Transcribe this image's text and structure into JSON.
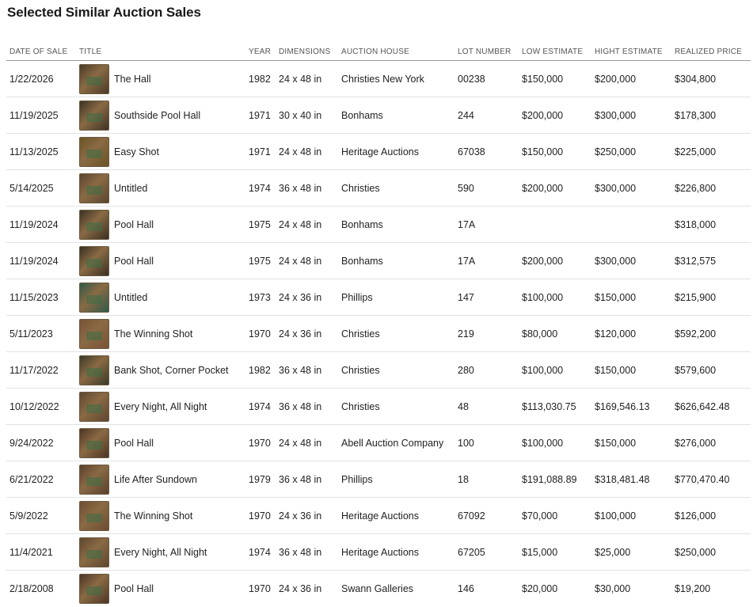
{
  "page": {
    "title": "Selected Similar Auction Sales"
  },
  "table": {
    "columns": {
      "date": "DATE OF SALE",
      "title": "TITLE",
      "year": "YEAR",
      "dimensions": "DIMENSIONS",
      "house": "AUCTION HOUSE",
      "lot": "LOT NUMBER",
      "low": "LOW ESTIMATE",
      "high": "HIGHT ESTIMATE",
      "price": "REALIZED PRICE"
    },
    "rows": [
      {
        "date": "1/22/2026",
        "title": "The Hall",
        "year": "1982",
        "dimensions": "24 x 48 in",
        "house": "Christies New York",
        "lot": "00238",
        "low": "$150,000",
        "high": "$200,000",
        "price": "$304,800",
        "thumb": "#4a3b28"
      },
      {
        "date": "11/19/2025",
        "title": "Southside Pool Hall",
        "year": "1971",
        "dimensions": "30 x 40 in",
        "house": "Bonhams",
        "lot": "244",
        "low": "$200,000",
        "high": "$300,000",
        "price": "$178,300",
        "thumb": "#3d3326"
      },
      {
        "date": "11/13/2025",
        "title": "Easy Shot",
        "year": "1971",
        "dimensions": "24 x 48 in",
        "house": "Heritage Auctions",
        "lot": "67038",
        "low": "$150,000",
        "high": "$250,000",
        "price": "$225,000",
        "thumb": "#6b5424"
      },
      {
        "date": "5/14/2025",
        "title": "Untitled",
        "year": "1974",
        "dimensions": "36 x 48 in",
        "house": "Christies",
        "lot": "590",
        "low": "$200,000",
        "high": "$300,000",
        "price": "$226,800",
        "thumb": "#5a4530"
      },
      {
        "date": "11/19/2024",
        "title": "Pool Hall",
        "year": "1975",
        "dimensions": "24 x 48 in",
        "house": "Bonhams",
        "lot": "17A",
        "low": "",
        "high": "",
        "price": "$318,000",
        "thumb": "#3a3022"
      },
      {
        "date": "11/19/2024",
        "title": "Pool Hall",
        "year": "1975",
        "dimensions": "24 x 48 in",
        "house": "Bonhams",
        "lot": "17A",
        "low": "$200,000",
        "high": "$300,000",
        "price": "$312,575",
        "thumb": "#3a3022"
      },
      {
        "date": "11/15/2023",
        "title": "Untitled",
        "year": "1973",
        "dimensions": "24 x 36 in",
        "house": "Phillips",
        "lot": "147",
        "low": "$100,000",
        "high": "$150,000",
        "price": "$215,900",
        "thumb": "#2f5a48"
      },
      {
        "date": "5/11/2023",
        "title": "The Winning Shot",
        "year": "1970",
        "dimensions": "24 x 36 in",
        "house": "Christies",
        "lot": "219",
        "low": "$80,000",
        "high": "$120,000",
        "price": "$592,200",
        "thumb": "#7a5236"
      },
      {
        "date": "11/17/2022",
        "title": "Bank Shot, Corner Pocket",
        "year": "1982",
        "dimensions": "36 x 48 in",
        "house": "Christies",
        "lot": "280",
        "low": "$100,000",
        "high": "$150,000",
        "price": "$579,600",
        "thumb": "#3b3a28"
      },
      {
        "date": "10/12/2022",
        "title": "Every Night, All Night",
        "year": "1974",
        "dimensions": "36 x 48 in",
        "house": "Christies",
        "lot": "48",
        "low": "$113,030.75",
        "high": "$169,546.13",
        "price": "$626,642.48",
        "thumb": "#5e4630"
      },
      {
        "date": "9/24/2022",
        "title": "Pool Hall",
        "year": "1970",
        "dimensions": "24 x 48 in",
        "house": "Abell Auction Company",
        "lot": "100",
        "low": "$100,000",
        "high": "$150,000",
        "price": "$276,000",
        "thumb": "#4d3424"
      },
      {
        "date": "6/21/2022",
        "title": "Life After Sundown",
        "year": "1979",
        "dimensions": "36 x 48 in",
        "house": "Phillips",
        "lot": "18",
        "low": "$191,088.89",
        "high": "$318,481.48",
        "price": "$770,470.40",
        "thumb": "#5a3f2e"
      },
      {
        "date": "5/9/2022",
        "title": "The Winning Shot",
        "year": "1970",
        "dimensions": "24 x 36 in",
        "house": "Heritage Auctions",
        "lot": "67092",
        "low": "$70,000",
        "high": "$100,000",
        "price": "$126,000",
        "thumb": "#6e4c32"
      },
      {
        "date": "11/4/2021",
        "title": "Every Night, All Night",
        "year": "1974",
        "dimensions": "36 x 48 in",
        "house": "Heritage Auctions",
        "lot": "67205",
        "low": "$15,000",
        "high": "$25,000",
        "price": "$250,000",
        "thumb": "#5e4630"
      },
      {
        "date": "2/18/2008",
        "title": "Pool Hall",
        "year": "1970",
        "dimensions": "24 x 36 in",
        "house": "Swann Galleries",
        "lot": "146",
        "low": "$20,000",
        "high": "$30,000",
        "price": "$19,200",
        "thumb": "#4d3626"
      }
    ]
  }
}
